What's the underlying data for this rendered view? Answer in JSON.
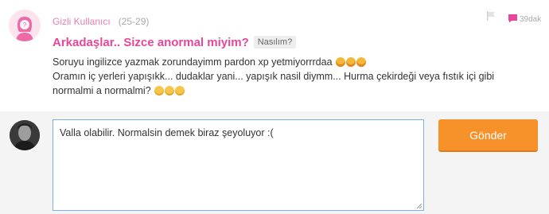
{
  "post": {
    "username": "Gizli Kullanıcı",
    "age": "(25-29)",
    "title": "Arkadaşlar.. Sizce anormal miyim?",
    "tag": "Nasılım?",
    "body_line1": "Soruyu ingilizce yazmak zorundayimm pardon xp yetmiyorrrdaa",
    "body_line2": "Oramın iç yerleri yapışıkk... dudaklar yani... yapışık nasil diymm... Hurma çekirdeği veya fıstık içi gibi normalmi a normalmi?",
    "time": "39dak",
    "icons": {
      "avatar": "female-avatar-icon",
      "flag": "flag-icon",
      "comment": "chat-bubble-icon",
      "emoji_laugh": "laughing-emoji",
      "emoji_sad": "sad-emoji"
    },
    "colors": {
      "accent": "#e5479a",
      "username": "#e77fb0"
    }
  },
  "reply": {
    "text": "Valla olabilir. Normalsin demek biraz şeyoluyor :(",
    "send_label": "Gönder",
    "colors": {
      "send_button": "#f7922b",
      "input_border": "#7fb0e6"
    }
  }
}
